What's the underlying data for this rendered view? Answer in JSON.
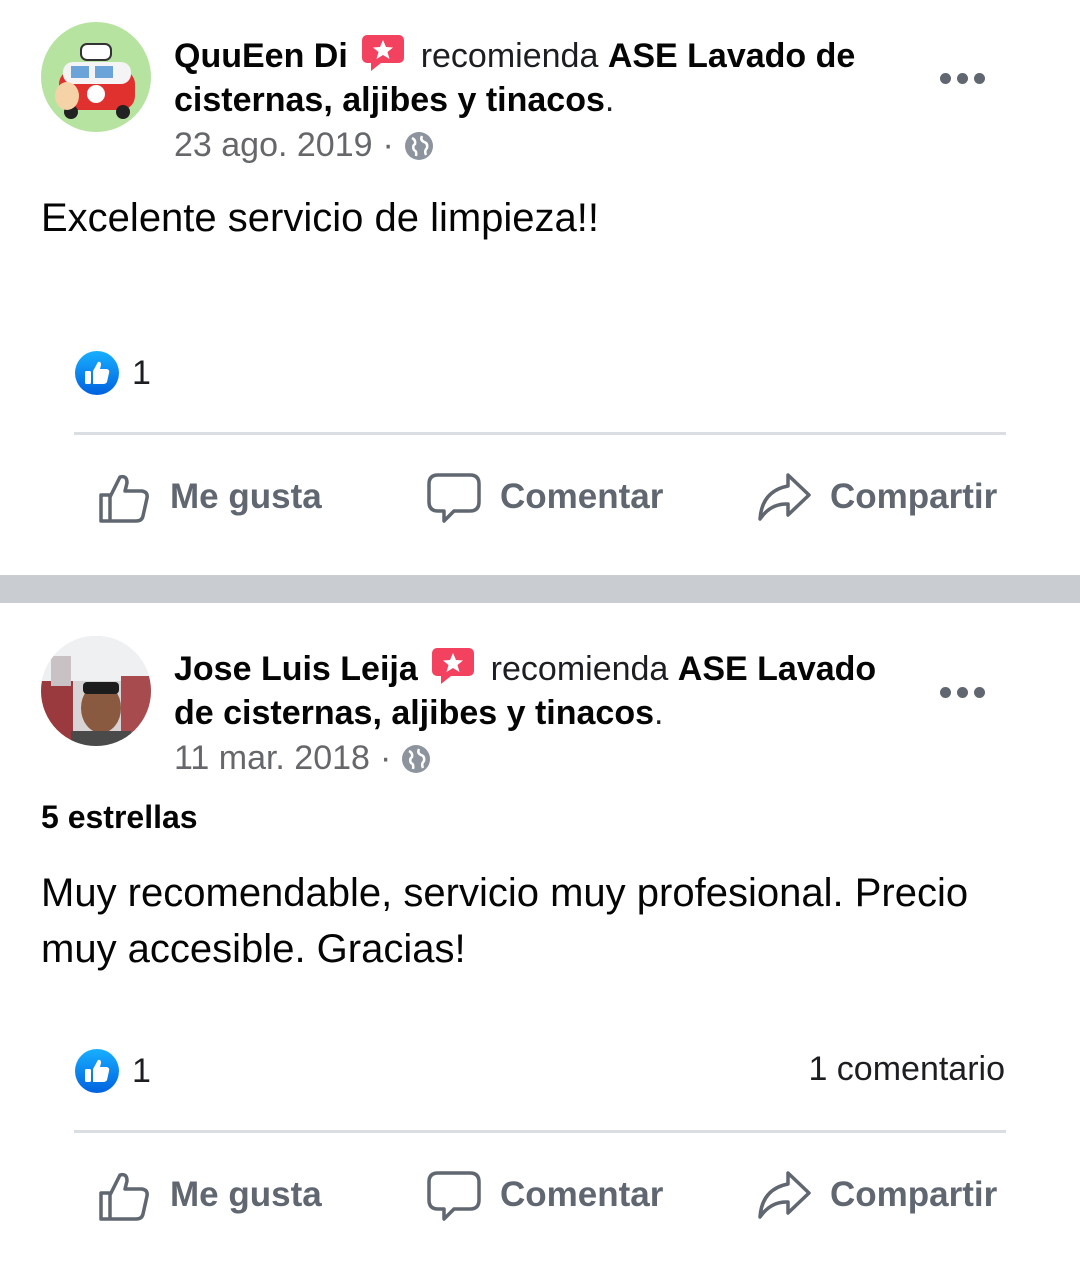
{
  "posts": [
    {
      "author": "QuuEen Di",
      "recommend_word": "recomienda",
      "page_name": "ASE Lavado de cisternas, aljibes y tinacos",
      "period": ".",
      "date": "23 ago. 2019",
      "date_separator": "·",
      "body": "Excelente servicio de limpieza!!",
      "like_count": "1",
      "actions": {
        "like": "Me gusta",
        "comment": "Comentar",
        "share": "Compartir"
      }
    },
    {
      "author": "Jose Luis Leija",
      "recommend_word": "recomienda",
      "page_name": "ASE Lavado de cisternas, aljibes y tinacos",
      "period": ".",
      "date": "11 mar. 2018",
      "date_separator": "·",
      "rating": "5 estrellas",
      "body": "Muy recomendable, servicio muy profesional. Precio muy accesible. Gracias!",
      "like_count": "1",
      "comment_count": "1 comentario",
      "actions": {
        "like": "Me gusta",
        "comment": "Comentar",
        "share": "Compartir"
      }
    }
  ],
  "colors": {
    "recommend_badge": "#f3425f",
    "like_blue": "#1877f2",
    "separator": "#c9ccd1",
    "secondary_text": "#65676b"
  },
  "icons": {
    "recommend": "recommend-star-bubble-icon",
    "globe": "globe-icon",
    "like_badge": "thumbs-up-badge-icon",
    "like_action": "thumbs-up-outline-icon",
    "comment_action": "speech-bubble-icon",
    "share_action": "share-arrow-icon",
    "more": "more-dots-icon"
  }
}
